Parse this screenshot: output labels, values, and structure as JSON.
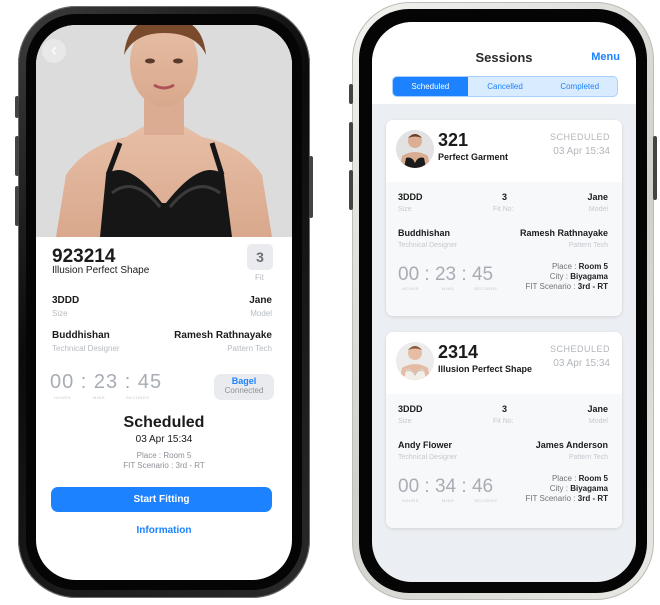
{
  "left": {
    "back_icon": "chevron-left-icon",
    "id": "923214",
    "name": "Illusion Perfect Shape",
    "fit_value": "3",
    "fit_label": "Fit",
    "size_value": "3DDD",
    "size_label": "Size",
    "model_value": "Jane",
    "model_label": "Model",
    "designer_value": "Buddhishan",
    "designer_label": "Technical Designer",
    "pattern_value": "Ramesh Rathnayake",
    "pattern_label": "Pattern Tech",
    "timer": {
      "hours": "00",
      "mins": "23",
      "seconds": "45",
      "hours_label": "HOURS",
      "mins_label": "MINS",
      "seconds_label": "SECONDS"
    },
    "bagel_title": "Bagel",
    "bagel_status": "Connected",
    "status": "Scheduled",
    "date": "03 Apr 15:34",
    "place": "Place : Room 5",
    "scenario": "FIT Scenario : 3rd - RT",
    "start_button": "Start Fitting",
    "info_link": "Information"
  },
  "right": {
    "title": "Sessions",
    "menu": "Menu",
    "tabs": [
      {
        "label": "Scheduled",
        "active": true
      },
      {
        "label": "Cancelled",
        "active": false
      },
      {
        "label": "Completed",
        "active": false
      }
    ],
    "cards": [
      {
        "id": "321",
        "name": "Perfect Garment",
        "status": "SCHEDULED",
        "date": "03 Apr 15:34",
        "size_value": "3DDD",
        "size_label": "Size",
        "fit_value": "3",
        "fit_label": "Fit No:",
        "model_value": "Jane",
        "model_label": "Model",
        "designer_value": "Buddhishan",
        "designer_label": "Technical Designer",
        "pattern_value": "Ramesh Rathnayake",
        "pattern_label": "Pattern Tech",
        "timer": {
          "hours": "00",
          "mins": "23",
          "seconds": "45"
        },
        "place_label": "Place :",
        "place_value": "Room 5",
        "city_label": "City :",
        "city_value": "Biyagama",
        "scenario_label": "FIT Scenario :",
        "scenario_value": "3rd - RT"
      },
      {
        "id": "2314",
        "name": "Illusion Perfect Shape",
        "status": "SCHEDULED",
        "date": "03 Apr 15:34",
        "size_value": "3DDD",
        "size_label": "Size",
        "fit_value": "3",
        "fit_label": "Fit No:",
        "model_value": "Jane",
        "model_label": "Model",
        "designer_value": "Andy Flower",
        "designer_label": "Technical Designer",
        "pattern_value": "James Anderson",
        "pattern_label": "Pattern Tech",
        "timer": {
          "hours": "00",
          "mins": "34",
          "seconds": "46"
        },
        "place_label": "Place :",
        "place_value": "Room 5",
        "city_label": "City :",
        "city_value": "Biyagama",
        "scenario_label": "FIT Scenario :",
        "scenario_value": "3rd - RT"
      }
    ],
    "timer_labels": {
      "hours": "HOURS",
      "mins": "MINS",
      "seconds": "SECONDS"
    }
  }
}
